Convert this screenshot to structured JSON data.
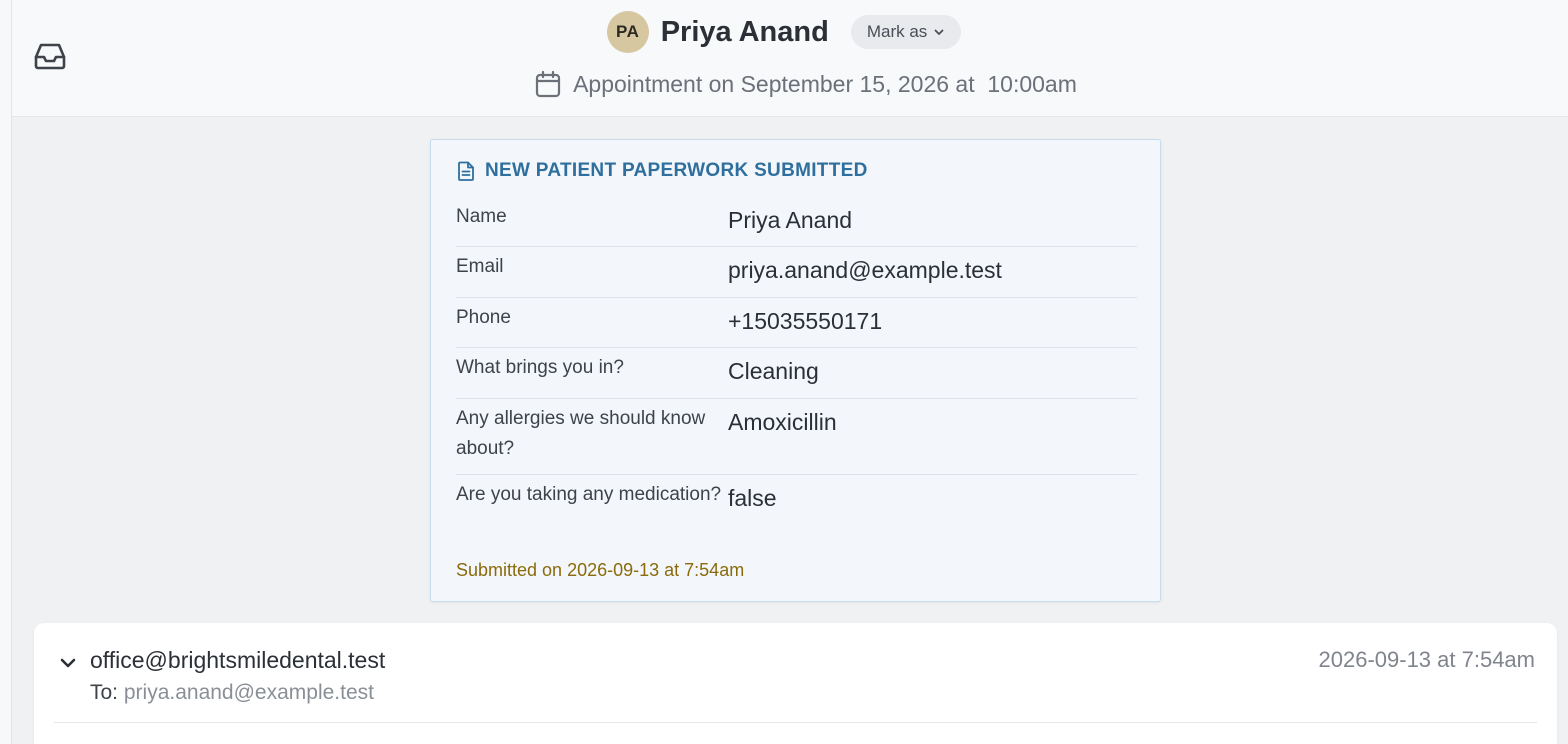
{
  "header": {
    "avatar_initials": "PA",
    "patient_name": "Priya Anand",
    "mark_as_label": "Mark as",
    "appointment_text": "Appointment on September 15, 2026 at  10:00am"
  },
  "paperwork": {
    "title": "NEW PATIENT PAPERWORK SUBMITTED",
    "rows": [
      {
        "label": "Name",
        "value": "Priya Anand"
      },
      {
        "label": "Email",
        "value": "priya.anand@example.test"
      },
      {
        "label": "Phone",
        "value": "+15035550171"
      },
      {
        "label": "What brings you in?",
        "value": "Cleaning"
      },
      {
        "label": "Any allergies we should know about?",
        "value": "Amoxicillin"
      },
      {
        "label": "Are you taking any medication?",
        "value": "false"
      }
    ],
    "submitted": "Submitted on 2026-09-13 at 7:54am"
  },
  "email": {
    "from": "office@brightsmiledental.test",
    "to_label": "To: ",
    "to_address": "priya.anand@example.test",
    "date": "2026-09-13 at 7:54am"
  },
  "colors": {
    "accent_blue": "#2f6f9e",
    "submitted_gold": "#8a6a0a",
    "avatar_bg": "#d6c7a1"
  },
  "icons": [
    "inbox-icon",
    "calendar-icon",
    "chevron-down-icon",
    "document-icon"
  ]
}
